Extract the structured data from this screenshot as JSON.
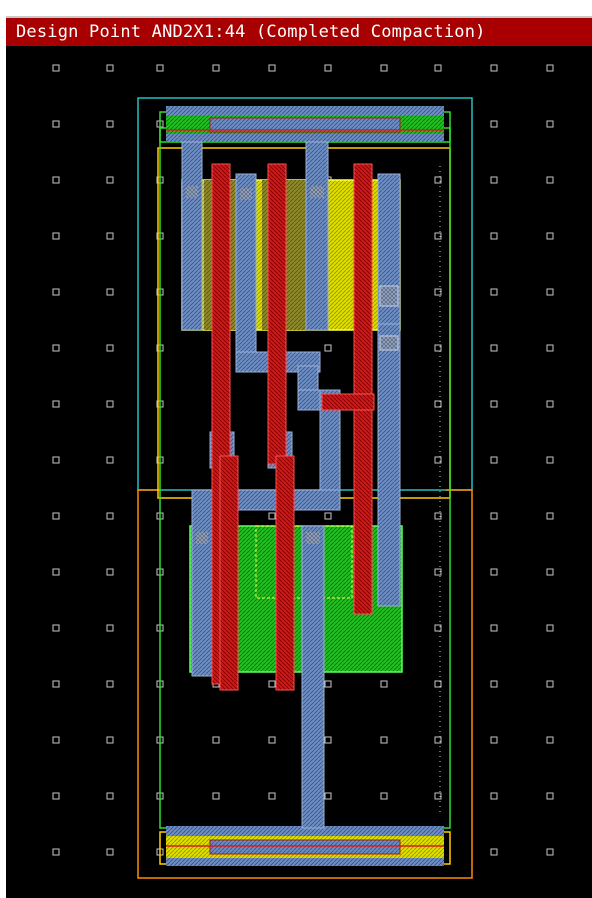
{
  "window": {
    "title": "Design Point AND2X1:44 (Completed Compaction)"
  },
  "colors": {
    "background": "#000000",
    "title_bar": "#a80000",
    "title_text": "#ffffff",
    "grid_dot": "#c8c8c8",
    "metal1": "#6f8fc4",
    "poly": "#d42020",
    "pdiff": "#e0e000",
    "ndiff": "#20c020",
    "cell_boundary": "#22c0c0",
    "well_outline": "#ff8c00",
    "nwell_outline": "#ffd000",
    "active_outline": "#30e030"
  },
  "layout": {
    "cell_name": "AND2X1",
    "point_index": "44",
    "layers": [
      "metal1",
      "poly",
      "pdiff",
      "ndiff",
      "contact",
      "cell-boundary",
      "well"
    ]
  }
}
